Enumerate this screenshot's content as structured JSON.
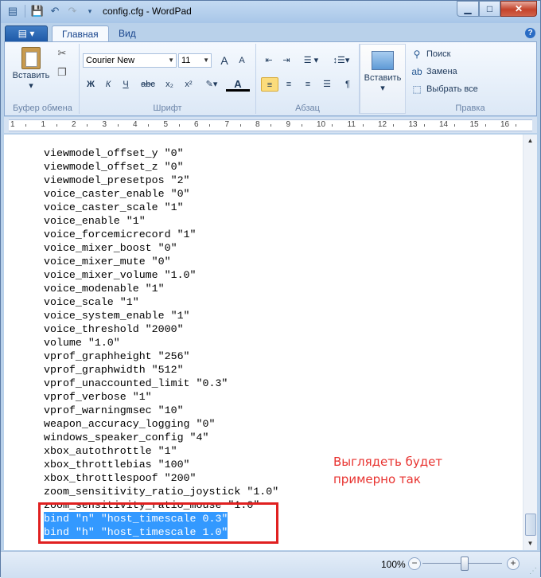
{
  "window": {
    "title": "config.cfg - WordPad",
    "min_icon": "minimize-icon",
    "max_icon": "maximize-icon",
    "close_icon": "close-icon"
  },
  "quick_access": {
    "save_icon": "save-icon",
    "undo_icon": "undo-icon",
    "redo_icon": "redo-icon",
    "customize_icon": "chevron-down-icon"
  },
  "ribbon": {
    "app_menu_icon": "app-menu-icon",
    "tabs": [
      {
        "label": "Главная",
        "active": true
      },
      {
        "label": "Вид",
        "active": false
      }
    ],
    "help_label": "?",
    "clipboard": {
      "group_label": "Буфер обмена",
      "paste_label": "Вставить",
      "paste_arrow": "▾"
    },
    "font": {
      "group_label": "Шрифт",
      "family": "Courier New",
      "size": "11",
      "grow": "A",
      "shrink": "A",
      "bold": "Ж",
      "italic": "К",
      "underline": "Ч",
      "strike": "abc",
      "sub": "x₂",
      "sup": "x²",
      "color_a": "A"
    },
    "paragraph": {
      "group_label": "Абзац"
    },
    "insert": {
      "label": "Вставить",
      "arrow": "▾"
    },
    "edit": {
      "group_label": "Правка",
      "find": "Поиск",
      "replace": "Замена",
      "select_all": "Выбрать все"
    }
  },
  "ruler": {
    "numbers": [
      "1",
      "1",
      "2",
      "3",
      "4",
      "5",
      "6",
      "7",
      "8",
      "9",
      "10",
      "11",
      "12",
      "13",
      "14",
      "15",
      "16"
    ]
  },
  "document": {
    "lines": [
      "viewmodel_offset_y \"0\"",
      "viewmodel_offset_z \"0\"",
      "viewmodel_presetpos \"2\"",
      "voice_caster_enable \"0\"",
      "voice_caster_scale \"1\"",
      "voice_enable \"1\"",
      "voice_forcemicrecord \"1\"",
      "voice_mixer_boost \"0\"",
      "voice_mixer_mute \"0\"",
      "voice_mixer_volume \"1.0\"",
      "voice_modenable \"1\"",
      "voice_scale \"1\"",
      "voice_system_enable \"1\"",
      "voice_threshold \"2000\"",
      "volume \"1.0\"",
      "vprof_graphheight \"256\"",
      "vprof_graphwidth \"512\"",
      "vprof_unaccounted_limit \"0.3\"",
      "vprof_verbose \"1\"",
      "vprof_warningmsec \"10\"",
      "weapon_accuracy_logging \"0\"",
      "windows_speaker_config \"4\"",
      "xbox_autothrottle \"1\"",
      "xbox_throttlebias \"100\"",
      "xbox_throttlespoof \"200\"",
      "zoom_sensitivity_ratio_joystick \"1.0\"",
      "zoom_sensitivity_ratio_mouse \"1.0\""
    ],
    "selected_lines": [
      "bind \"n\" \"host_timescale 0.3\"",
      "bind \"h\" \"host_timescale 1.0\""
    ],
    "annotation": [
      "Выглядеть будет",
      "примерно так"
    ],
    "annotation_color": "#e8322f",
    "selection_color": "#3399ff"
  },
  "status": {
    "zoom": "100%",
    "zoom_out": "−",
    "zoom_in": "+"
  }
}
